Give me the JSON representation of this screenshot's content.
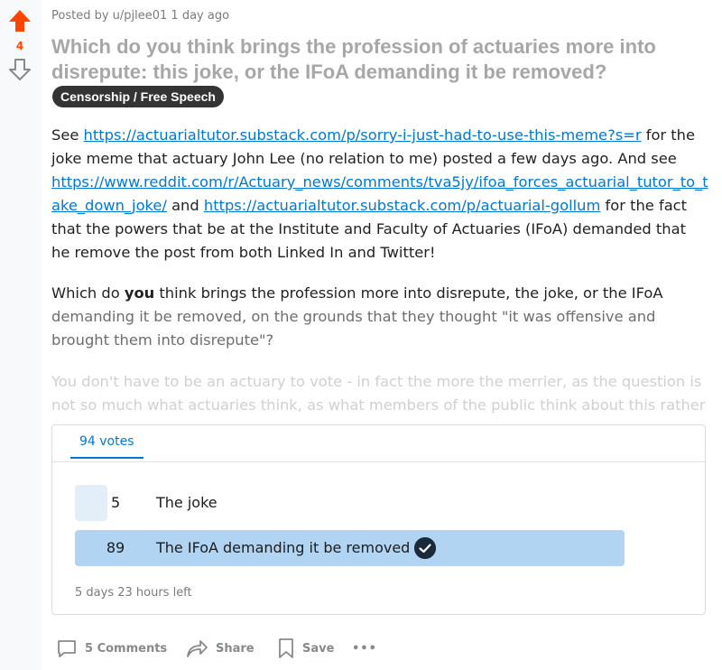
{
  "post": {
    "score": "4",
    "meta": "Posted by u/pjlee01 1 day ago",
    "title": "Which do you think brings the profession of actuaries more into disrepute: this joke, or the IFoA demanding it be removed?",
    "flair": "Censorship / Free Speech",
    "p1": {
      "t1": "See ",
      "link1": "https://actuarialtutor.substack.com/p/sorry-i-just-had-to-use-this-meme?s=r",
      "t2": " for the joke meme that actuary John Lee (no relation to me) posted a few days ago. And see ",
      "link2": "https://www.reddit.com/r/Actuary_news/comments/tva5jy/ifoa_forces_actuarial_tutor_to_take_down_joke/",
      "t3": " and ",
      "link3": "https://actuarialtutor.substack.com/p/actuarial-gollum",
      "t4": " for the fact that the powers that be at the Institute and Faculty of Actuaries (IFoA) demanded that he remove the post from both Linked In and Twitter!"
    },
    "p2": {
      "t1": "Which do ",
      "bold": "you",
      "t2": " think brings the profession more into disrepute, the joke, or the IFoA ",
      "t3": "demanding it be removed, on the grounds that they thought \"it was offensive and brought them into disrepute\"?"
    },
    "p3": "You don't have to be an actuary to vote - in fact the more the merrier, as the question is not so much what actuaries think, as what members of the public think about this rather"
  },
  "poll": {
    "total_votes": "94 votes",
    "options": [
      {
        "count": "5",
        "label": "The joke",
        "share": 0.053,
        "selected": false
      },
      {
        "count": "89",
        "label": "The IFoA demanding it be removed",
        "share": 0.947,
        "selected": true
      }
    ],
    "time_left": "5 days 23 hours left"
  },
  "actions": {
    "comments": "5 Comments",
    "share": "Share",
    "save": "Save",
    "more": "•••"
  },
  "colors": {
    "upvote": "#ff4500",
    "link": "#0079d3",
    "poll_fill_low": "#e3eef9",
    "poll_fill_winner": "#b0d4f1"
  }
}
